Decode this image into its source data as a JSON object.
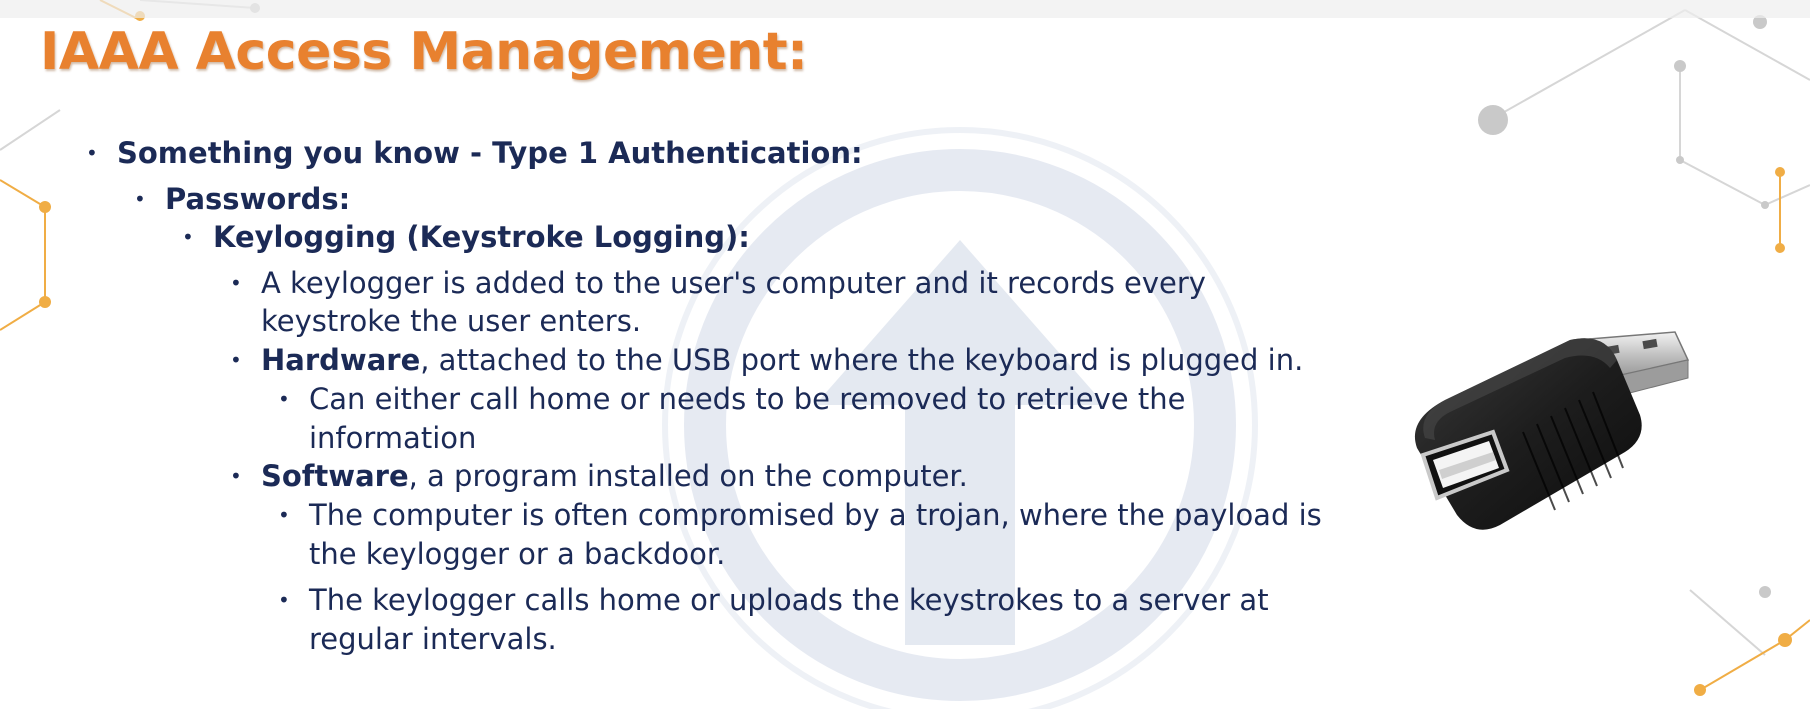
{
  "slide": {
    "title": "IAAA Access Management:",
    "bullets": {
      "l1": "Something you know - Type 1 Authentication:",
      "l2": "Passwords:",
      "l3": "Keylogging (Keystroke Logging):",
      "l4a_line1": "A keylogger is added to the user's computer and it records every",
      "l4a_line2": "keystroke the user enters.",
      "l4b_bold": "Hardware",
      "l4b_rest": ", attached to the USB port where the keyboard is plugged in.",
      "l5a_line1": "Can either call home or needs to be removed to retrieve the",
      "l5a_line2": "information",
      "l4c_bold": "Software",
      "l4c_rest": ", a program installed on the computer.",
      "l5b_line1": "The computer is often compromised by a trojan, where the payload is",
      "l5b_line2": "the keylogger or a backdoor.",
      "l5c_line1": "The keylogger calls home or uploads the keystrokes to a server at",
      "l5c_line2": "regular intervals."
    },
    "bullet_glyph": "•"
  },
  "colors": {
    "title": "#e8812f",
    "text": "#1b2a56",
    "watermark": "#dde3ee",
    "network_orange": "#f0ad45",
    "network_gray": "#c9c9c9"
  },
  "icons": {
    "device": "usb-keylogger-image",
    "background": "upload-arrow-watermark"
  }
}
